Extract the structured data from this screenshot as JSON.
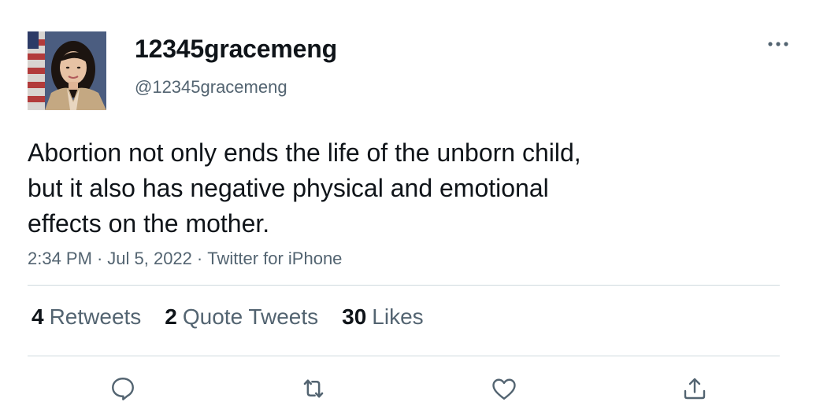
{
  "author": {
    "display_name": "12345gracemeng",
    "handle": "@12345gracemeng",
    "avatar_icon": "profile-photo"
  },
  "tweet": {
    "text": "Abortion not only ends the life of the unborn child,\nbut it also has negative physical and emotional\neffects on the mother.",
    "time": "2:34 PM",
    "date": "Jul 5, 2022",
    "source": "Twitter for iPhone",
    "separator": "·"
  },
  "stats": {
    "retweets": {
      "count": "4",
      "label": "Retweets"
    },
    "quote_tweets": {
      "count": "2",
      "label": "Quote Tweets"
    },
    "likes": {
      "count": "30",
      "label": "Likes"
    }
  },
  "actions": [
    {
      "name": "reply",
      "icon": "speech-bubble-icon"
    },
    {
      "name": "retweet",
      "icon": "retweet-arrows-icon"
    },
    {
      "name": "like",
      "icon": "heart-icon"
    },
    {
      "name": "share",
      "icon": "share-upload-icon"
    }
  ],
  "colors": {
    "text_primary": "#0f1419",
    "text_secondary": "#536471",
    "divider": "#cfd9de",
    "background": "#ffffff"
  }
}
